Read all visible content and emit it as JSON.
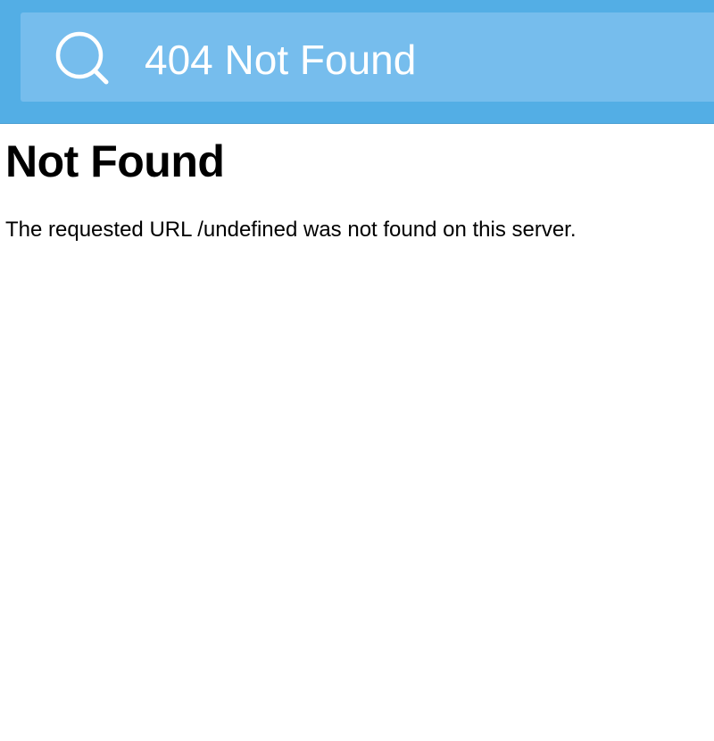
{
  "header": {
    "search_text": "404 Not Found",
    "search_icon": "search-icon",
    "colors": {
      "bar": "#53aee5",
      "search_box": "#76bded",
      "text": "#ffffff"
    }
  },
  "main": {
    "heading": "Not Found",
    "message": "The requested URL /undefined was not found on this server."
  }
}
